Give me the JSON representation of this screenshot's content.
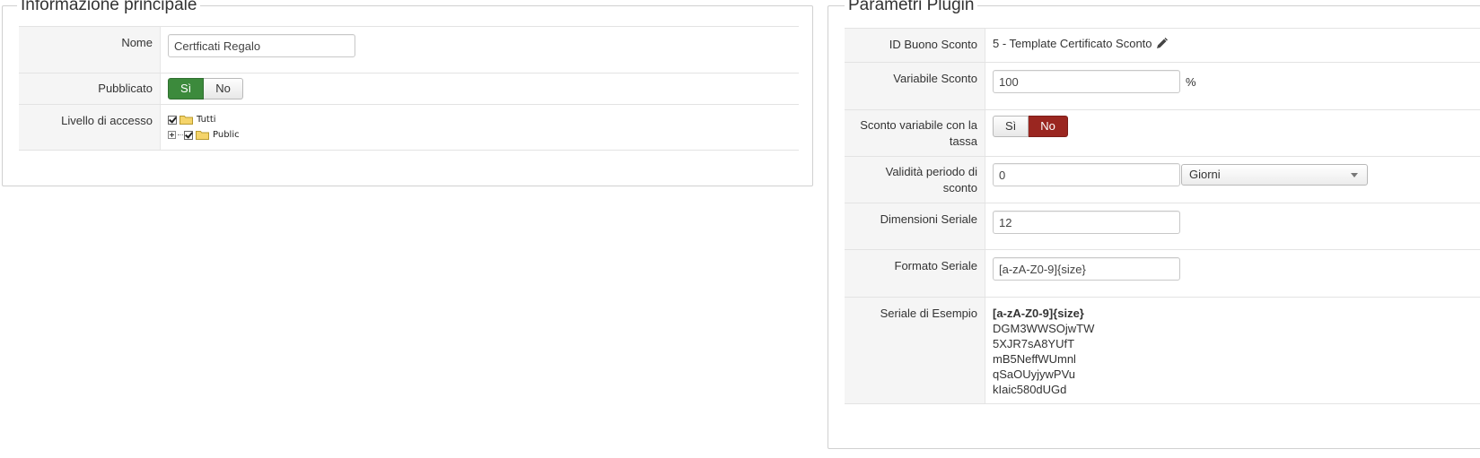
{
  "left_panel": {
    "title": "Informazione principale",
    "nome_label": "Nome",
    "nome_value": "Certficati Regalo",
    "pubblicato_label": "Pubblicato",
    "pubblicato_yes": "Sì",
    "pubblicato_no": "No",
    "accesso_label": "Livello di accesso",
    "tree": [
      "Tutti",
      "Public"
    ]
  },
  "right_panel": {
    "title": "Parametri Plugin",
    "id_buono_label": "ID Buono Sconto",
    "id_buono_value": "5 - Template Certificato Sconto",
    "variabile_label": "Variabile Sconto",
    "variabile_value": "100",
    "variabile_unit": "%",
    "sconto_tassa_label": "Sconto variabile con la tassa",
    "sconto_tassa_yes": "Sì",
    "sconto_tassa_no": "No",
    "validita_label": "Validità periodo di sconto",
    "validita_value": "0",
    "validita_unit": "Giorni",
    "dimensioni_label": "Dimensioni Seriale",
    "dimensioni_value": "12",
    "formato_label": "Formato Seriale",
    "formato_value": "[a-zA-Z0-9]{size}",
    "esempio_label": "Seriale di Esempio",
    "esempio_pattern": "[a-zA-Z0-9]{size}",
    "esempio_serials": [
      "DGM3WWSOjwTW",
      "5XJR7sA8YUfT",
      "mB5NeffWUmnl",
      "qSaOUyjywPVu",
      "kIaic580dUGd"
    ]
  },
  "colors": {
    "accent_green": "#3c8a3c",
    "accent_red": "#9a2620"
  },
  "icons": [
    "checkbox-icon",
    "folder-icon",
    "expand-icon",
    "pencil-icon",
    "chevron-down-icon"
  ]
}
